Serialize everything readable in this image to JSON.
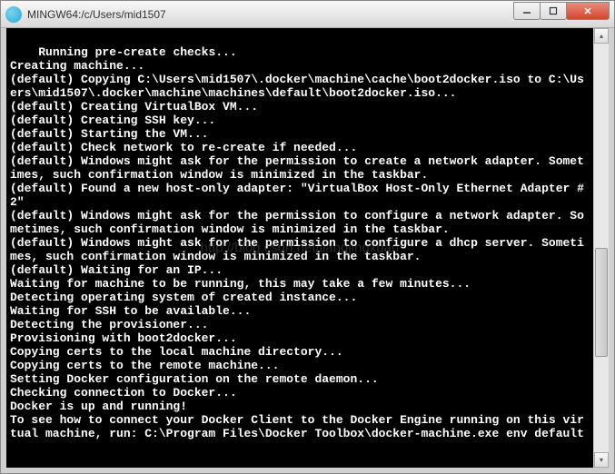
{
  "window": {
    "title": "MINGW64:/c/Users/mid1507"
  },
  "terminal": {
    "lines": [
      "Running pre-create checks...",
      "Creating machine...",
      "(default) Copying C:\\Users\\mid1507\\.docker\\machine\\cache\\boot2docker.iso to C:\\Users\\mid1507\\.docker\\machine\\machines\\default\\boot2docker.iso...",
      "(default) Creating VirtualBox VM...",
      "(default) Creating SSH key...",
      "(default) Starting the VM...",
      "(default) Check network to re-create if needed...",
      "(default) Windows might ask for the permission to create a network adapter. Sometimes, such confirmation window is minimized in the taskbar.",
      "(default) Found a new host-only adapter: \"VirtualBox Host-Only Ethernet Adapter #2\"",
      "(default) Windows might ask for the permission to configure a network adapter. Sometimes, such confirmation window is minimized in the taskbar.",
      "(default) Windows might ask for the permission to configure a dhcp server. Sometimes, such confirmation window is minimized in the taskbar.",
      "(default) Waiting for an IP...",
      "Waiting for machine to be running, this may take a few minutes...",
      "Detecting operating system of created instance...",
      "Waiting for SSH to be available...",
      "Detecting the provisioner...",
      "Provisioning with boot2docker...",
      "Copying certs to the local machine directory...",
      "Copying certs to the remote machine...",
      "Setting Docker configuration on the remote daemon...",
      "Checking connection to Docker...",
      "Docker is up and running!",
      "To see how to connect your Docker Client to the Docker Engine running on this virtual machine, run: C:\\Program Files\\Docker Toolbox\\docker-machine.exe env default"
    ]
  },
  "watermark": "http://blog.csdn.net/liangjingxuan"
}
